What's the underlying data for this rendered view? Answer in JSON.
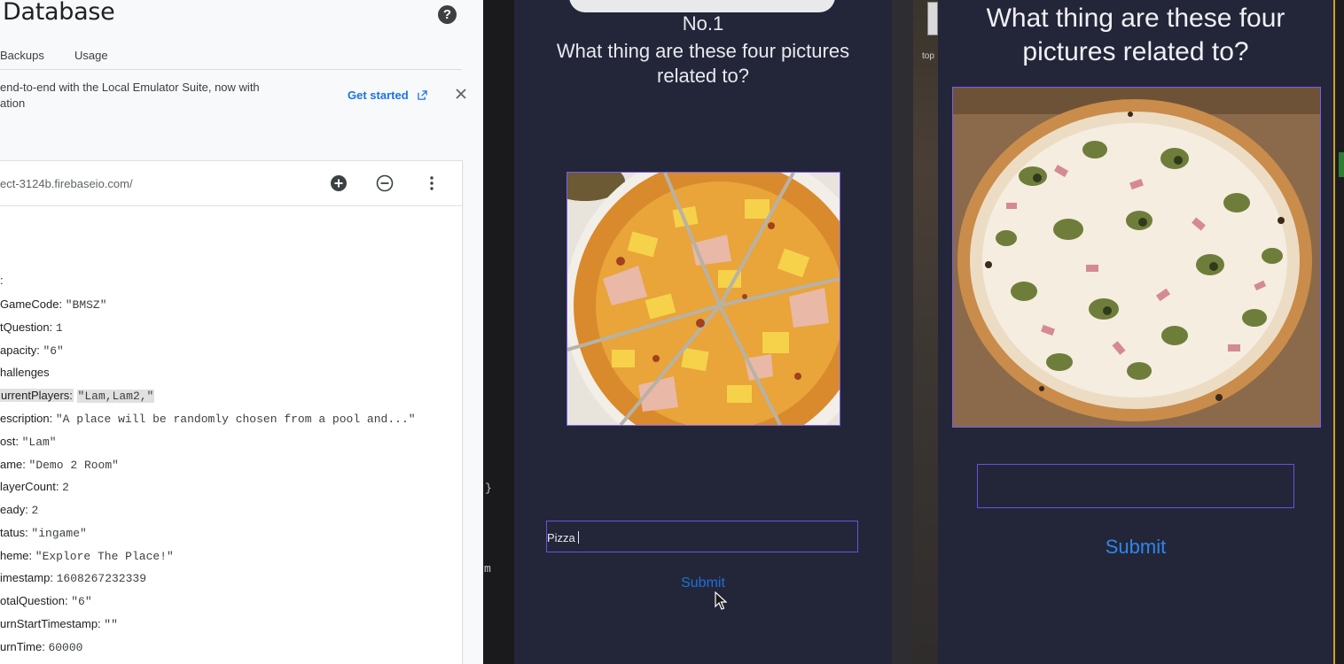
{
  "firebase": {
    "title": "Database",
    "help_icon": "?",
    "tabs": [
      "Backups",
      "Usage"
    ],
    "banner": {
      "text_line1": "end-to-end with the Local Emulator Suite, now with",
      "text_line2": "ation",
      "link": "Get started"
    },
    "db_url": "ect-3124b.firebaseio.com/",
    "tree": [
      {
        "key": ":",
        "value": ""
      },
      {
        "key": "GameCode:",
        "value": "\"BMSZ\""
      },
      {
        "key": "tQuestion:",
        "value": "1"
      },
      {
        "key": "apacity:",
        "value": "\"6\""
      },
      {
        "key": "hallenges",
        "value": ""
      },
      {
        "key": "urrentPlayers:",
        "value": "\"Lam,Lam2,\""
      },
      {
        "key": "escription:",
        "value": "\"A place will be randomly chosen from a pool and...\""
      },
      {
        "key": "ost:",
        "value": "\"Lam\""
      },
      {
        "key": "ame:",
        "value": "\"Demo 2 Room\""
      },
      {
        "key": "layerCount:",
        "value": "2"
      },
      {
        "key": "eady:",
        "value": "2"
      },
      {
        "key": "tatus:",
        "value": "\"ingame\""
      },
      {
        "key": "heme:",
        "value": "\"Explore The Place!\""
      },
      {
        "key": "imestamp:",
        "value": "1608267232339"
      },
      {
        "key": "otalQuestion:",
        "value": "\"6\""
      },
      {
        "key": "urnStartTimestamp:",
        "value": "\"\""
      },
      {
        "key": "urnTime:",
        "value": "60000"
      }
    ]
  },
  "strip": {
    "chars": [
      "}",
      "m"
    ]
  },
  "phone1": {
    "question_number": "No.1",
    "question": "What thing are these four pictures related to?",
    "answer_value": "Pizza",
    "submit_label": "Submit"
  },
  "gap": {
    "text": "top"
  },
  "phone2": {
    "question": "What thing are these four pictures related to?",
    "answer_value": "",
    "submit_label": "Submit"
  },
  "colors": {
    "accent": "#1a73e8",
    "submit": "#1f6fd6",
    "border": "#6b4fe0",
    "phone_bg": "#232639"
  }
}
